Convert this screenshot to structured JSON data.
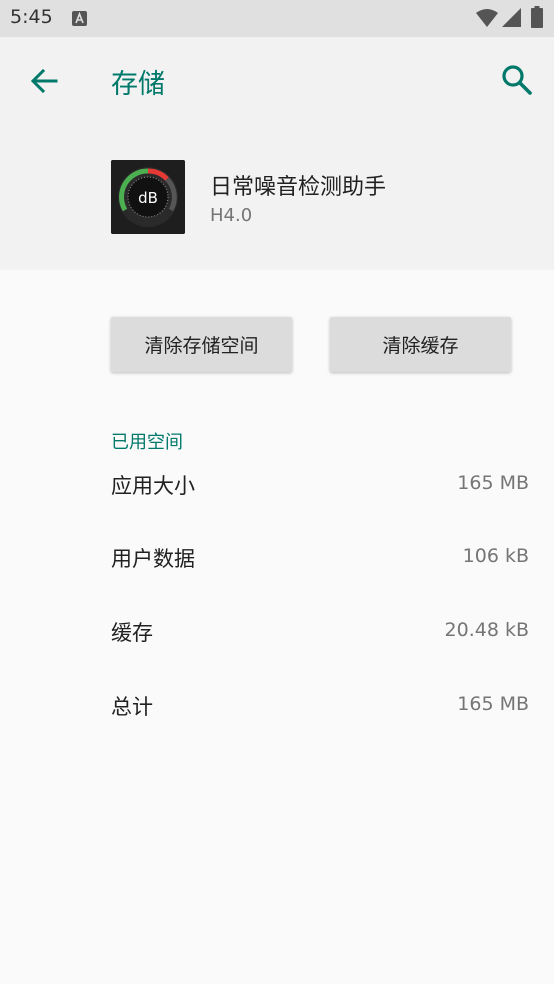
{
  "status_bar": {
    "time": "5:45",
    "icons": [
      "a-notification-icon",
      "wifi-icon",
      "signal-icon",
      "battery-icon"
    ]
  },
  "app_bar": {
    "title": "存储",
    "icons": [
      "back-arrow-icon",
      "search-icon"
    ]
  },
  "app_info": {
    "icon_text": "dB",
    "name": "日常噪音检测助手",
    "version": "H4.0"
  },
  "buttons": {
    "clear_storage": "清除存储空间",
    "clear_cache": "清除缓存"
  },
  "section": {
    "title": "已用空间"
  },
  "storage_rows": [
    {
      "label": "应用大小",
      "value": "165 MB"
    },
    {
      "label": "用户数据",
      "value": "106 kB"
    },
    {
      "label": "缓存",
      "value": "20.48 kB"
    },
    {
      "label": "总计",
      "value": "165 MB"
    }
  ],
  "colors": {
    "accent": "#00796b",
    "status_bar_bg": "#e0e0e0",
    "header_bg": "#f2f2f2",
    "button_bg": "#dcdcdc"
  }
}
